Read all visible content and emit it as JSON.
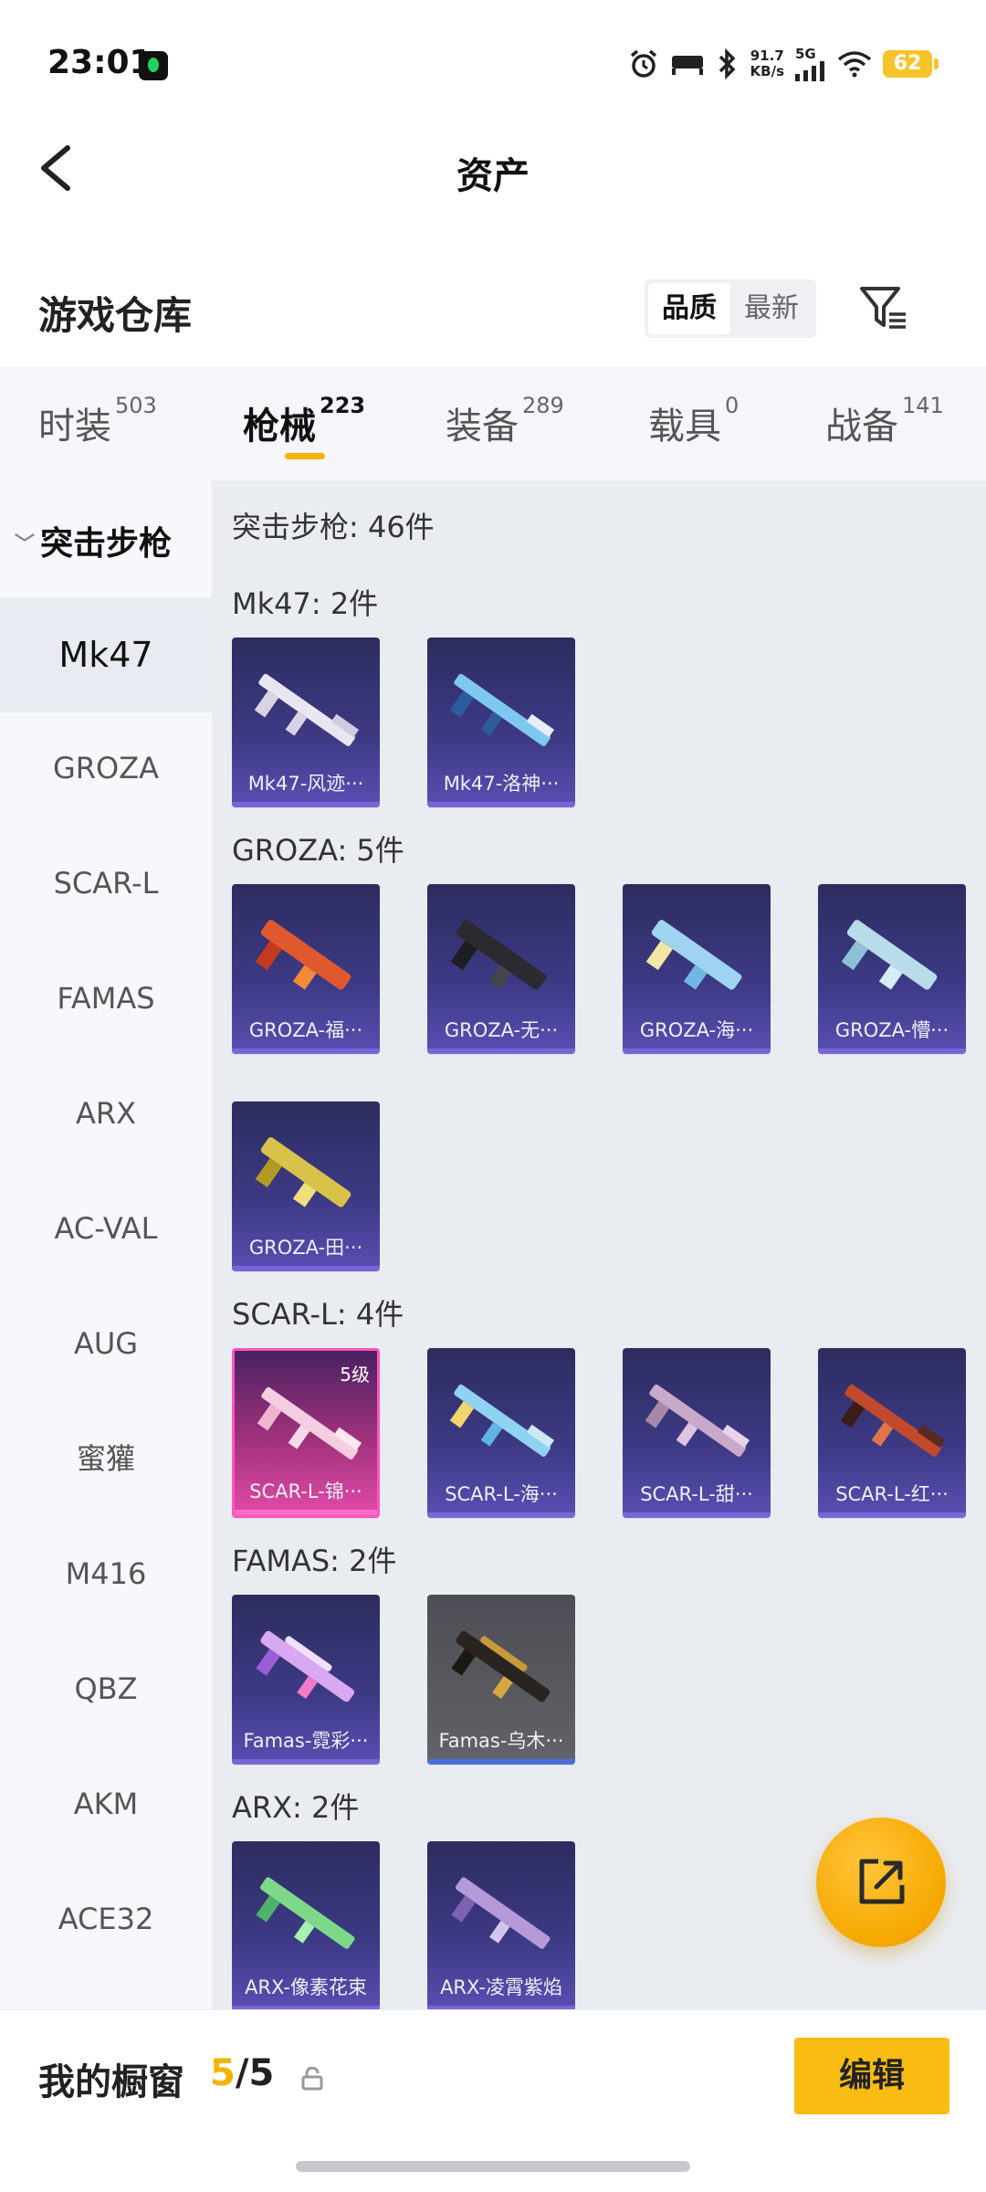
{
  "status_bar": {
    "time": "23:01",
    "net_speed_value": "91.7",
    "net_speed_unit": "KB/s",
    "network": "5G",
    "battery": "62",
    "icons": [
      "alarm-icon",
      "bed-icon",
      "bluetooth-icon",
      "signal-icon",
      "wifi-icon"
    ]
  },
  "header": {
    "title": "资产"
  },
  "warehouse": {
    "title": "游戏仓库",
    "sort_options": [
      "品质",
      "最新"
    ],
    "active_sort": "品质"
  },
  "tabs": [
    {
      "label": "时装",
      "count": "503"
    },
    {
      "label": "枪械",
      "count": "223"
    },
    {
      "label": "装备",
      "count": "289"
    },
    {
      "label": "载具",
      "count": "0"
    },
    {
      "label": "战备",
      "count": "141"
    }
  ],
  "sidebar": {
    "category": "突击步枪",
    "items": [
      "Mk47",
      "GROZA",
      "SCAR-L",
      "FAMAS",
      "ARX",
      "AC-VAL",
      "AUG",
      "蜜獾",
      "M416",
      "QBZ",
      "AKM",
      "ACE32"
    ]
  },
  "content": {
    "summary": "突击步枪: 46件",
    "groups": [
      {
        "title": "Mk47: 2件",
        "items": [
          {
            "label": "Mk47-风迹···"
          },
          {
            "label": "Mk47-洛神···"
          }
        ]
      },
      {
        "title": "GROZA: 5件",
        "items": [
          {
            "label": "GROZA-福···"
          },
          {
            "label": "GROZA-无···"
          },
          {
            "label": "GROZA-海···"
          },
          {
            "label": "GROZA-懵···"
          },
          {
            "label": "GROZA-田···"
          }
        ]
      },
      {
        "title": "SCAR-L: 4件",
        "items": [
          {
            "label": "SCAR-L-锦···",
            "level": "5级"
          },
          {
            "label": "SCAR-L-海···"
          },
          {
            "label": "SCAR-L-甜···"
          },
          {
            "label": "SCAR-L-红···"
          }
        ]
      },
      {
        "title": "FAMAS: 2件",
        "items": [
          {
            "label": "Famas-霓彩···"
          },
          {
            "label": "Famas-乌木···"
          }
        ]
      },
      {
        "title": "ARX: 2件",
        "items": [
          {
            "label": "ARX-像素花束"
          },
          {
            "label": "ARX-凌霄紫焰"
          }
        ]
      }
    ]
  },
  "bottom": {
    "window_label": "我的橱窗",
    "current": "5",
    "separator": "/",
    "total": "5",
    "edit_label": "编辑"
  },
  "colors": {
    "accent": "#f5b300",
    "card_purple": "#3d3a86",
    "card_pink": "#e14aa8",
    "card_gray": "#5b5c62"
  }
}
